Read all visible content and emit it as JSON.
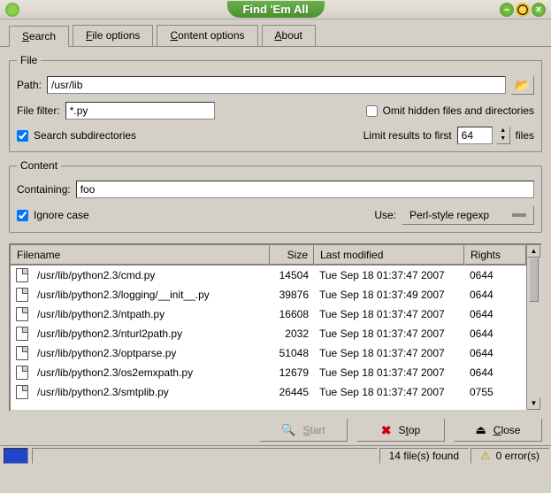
{
  "window": {
    "title": "Find 'Em All"
  },
  "tabs": [
    {
      "label": "Search",
      "accel": "S",
      "active": true
    },
    {
      "label": "File options",
      "accel": "F"
    },
    {
      "label": "Content options",
      "accel": "C"
    },
    {
      "label": "About",
      "accel": "A"
    }
  ],
  "file": {
    "legend": "File",
    "path_label": "Path:",
    "path_value": "/usr/lib",
    "filter_label": "File filter:",
    "filter_value": "*.py",
    "omit_label": "Omit hidden files and directories",
    "omit_checked": false,
    "subdir_label": "Search subdirectories",
    "subdir_checked": true,
    "limit_label": "Limit results to first",
    "limit_value": "64",
    "limit_suffix": "files"
  },
  "content": {
    "legend": "Content",
    "containing_label": "Containing:",
    "containing_value": "foo",
    "ignore_case_label": "Ignore case",
    "ignore_case_checked": true,
    "use_label": "Use:",
    "regexp_mode": "Perl-style regexp"
  },
  "columns": {
    "filename": "Filename",
    "size": "Size",
    "modified": "Last modified",
    "rights": "Rights"
  },
  "results": [
    {
      "name": "/usr/lib/python2.3/cmd.py",
      "size": "14504",
      "modified": "Tue Sep 18 01:37:47 2007",
      "rights": "0644"
    },
    {
      "name": "/usr/lib/python2.3/logging/__init__.py",
      "size": "39876",
      "modified": "Tue Sep 18 01:37:49 2007",
      "rights": "0644"
    },
    {
      "name": "/usr/lib/python2.3/ntpath.py",
      "size": "16608",
      "modified": "Tue Sep 18 01:37:47 2007",
      "rights": "0644"
    },
    {
      "name": "/usr/lib/python2.3/nturl2path.py",
      "size": "2032",
      "modified": "Tue Sep 18 01:37:47 2007",
      "rights": "0644"
    },
    {
      "name": "/usr/lib/python2.3/optparse.py",
      "size": "51048",
      "modified": "Tue Sep 18 01:37:47 2007",
      "rights": "0644"
    },
    {
      "name": "/usr/lib/python2.3/os2emxpath.py",
      "size": "12679",
      "modified": "Tue Sep 18 01:37:47 2007",
      "rights": "0644"
    },
    {
      "name": "/usr/lib/python2.3/smtplib.py",
      "size": "26445",
      "modified": "Tue Sep 18 01:37:47 2007",
      "rights": "0755"
    }
  ],
  "buttons": {
    "start": "Start",
    "stop": "Stop",
    "close": "Close"
  },
  "status": {
    "found": "14 file(s) found",
    "errors": "0 error(s)"
  }
}
